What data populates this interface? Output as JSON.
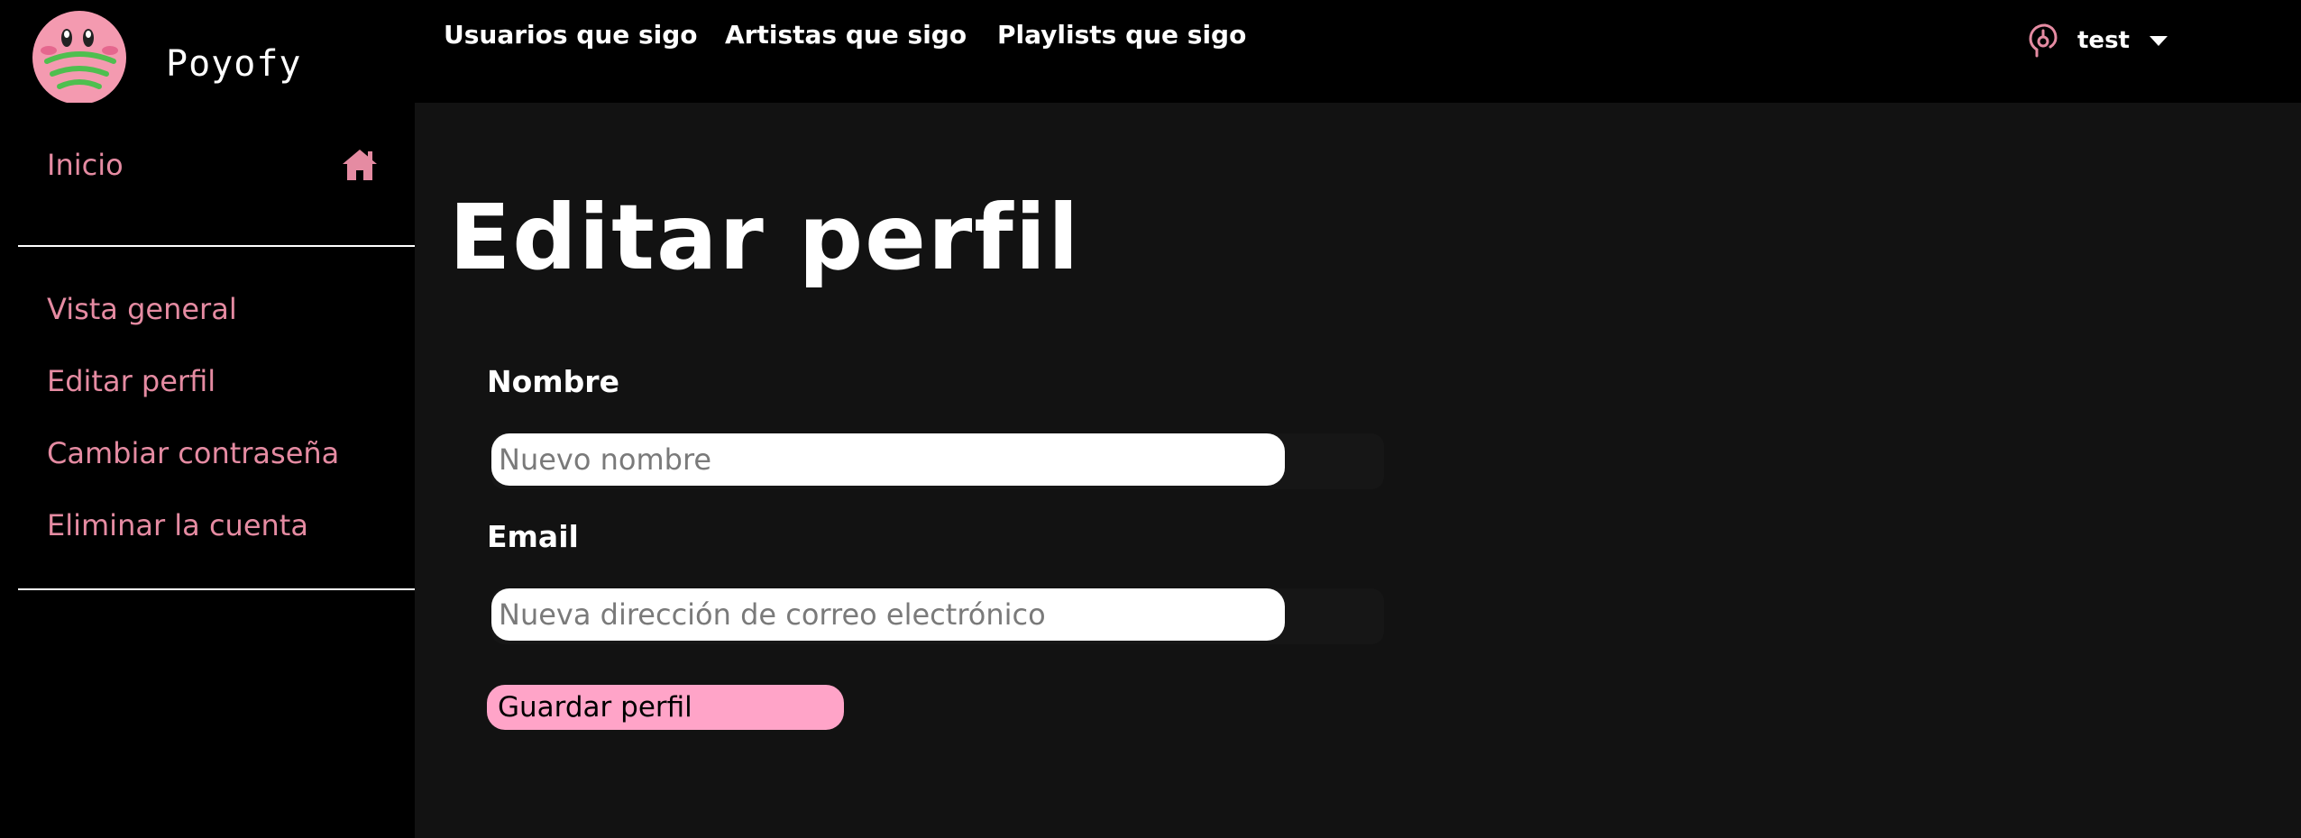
{
  "app": {
    "name": "Poyofy"
  },
  "topnav": {
    "links": [
      "Usuarios que sigo",
      "Artistas que sigo",
      "Playlists que sigo"
    ],
    "user": {
      "name": "test"
    }
  },
  "sidebar": {
    "home_label": "Inicio",
    "items": [
      "Vista general",
      "Editar perfil",
      "Cambiar contraseña",
      "Eliminar la cuenta"
    ]
  },
  "main": {
    "title": "Editar perfil",
    "name_label": "Nombre",
    "name_placeholder": "Nuevo nombre",
    "email_label": "Email",
    "email_placeholder": "Nueva dirección de correo electrónico",
    "save_label": "Guardar perfil"
  },
  "colors": {
    "accent_pink": "#e58ba2",
    "button_pink": "#ffa4c8",
    "topbar_bg": "#000000",
    "main_bg": "#121212"
  },
  "icons": {
    "home": "home-icon",
    "user": "user-headphones-icon",
    "caret": "caret-down-icon"
  }
}
